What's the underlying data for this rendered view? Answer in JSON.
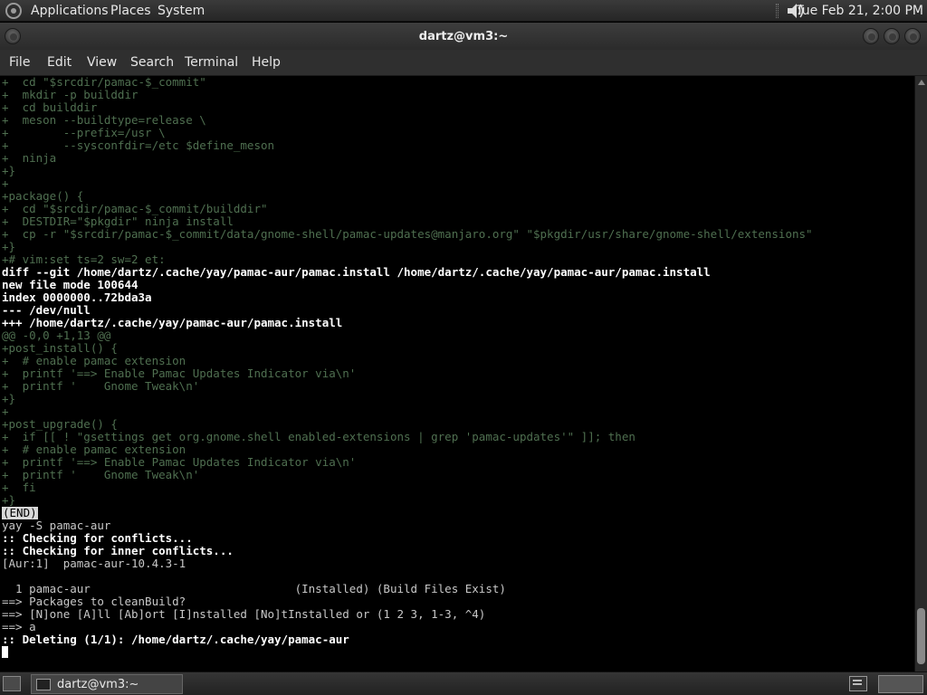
{
  "top_panel": {
    "menus": [
      "Applications",
      "Places",
      "System"
    ],
    "clock": "Tue Feb 21,  2:00 PM"
  },
  "window": {
    "title": "dartz@vm3:~"
  },
  "menubar": [
    "File",
    "Edit",
    "View",
    "Search",
    "Terminal",
    "Help"
  ],
  "terminal": {
    "lines": [
      {
        "style": "dim",
        "text": "+  cd \"$srcdir/pamac-$_commit\""
      },
      {
        "style": "dim",
        "text": "+  mkdir -p builddir"
      },
      {
        "style": "dim",
        "text": "+  cd builddir"
      },
      {
        "style": "dim",
        "text": "+  meson --buildtype=release \\"
      },
      {
        "style": "dim",
        "text": "+        --prefix=/usr \\"
      },
      {
        "style": "dim",
        "text": "+        --sysconfdir=/etc $define_meson"
      },
      {
        "style": "dim",
        "text": "+  ninja"
      },
      {
        "style": "dim",
        "text": "+}"
      },
      {
        "style": "dim",
        "text": "+"
      },
      {
        "style": "dim",
        "text": "+package() {"
      },
      {
        "style": "dim",
        "text": "+  cd \"$srcdir/pamac-$_commit/builddir\""
      },
      {
        "style": "dim",
        "text": "+  DESTDIR=\"$pkgdir\" ninja install"
      },
      {
        "style": "dim",
        "text": "+  cp -r \"$srcdir/pamac-$_commit/data/gnome-shell/pamac-updates@manjaro.org\" \"$pkgdir/usr/share/gnome-shell/extensions\""
      },
      {
        "style": "dim",
        "text": "+}"
      },
      {
        "style": "dim",
        "text": "+# vim:set ts=2 sw=2 et:"
      },
      {
        "style": "bold",
        "text": "diff --git /home/dartz/.cache/yay/pamac-aur/pamac.install /home/dartz/.cache/yay/pamac-aur/pamac.install"
      },
      {
        "style": "bold",
        "text": "new file mode 100644"
      },
      {
        "style": "bold",
        "text": "index 0000000..72bda3a"
      },
      {
        "style": "bold",
        "text": "--- /dev/null"
      },
      {
        "style": "bold",
        "text": "+++ /home/dartz/.cache/yay/pamac-aur/pamac.install"
      },
      {
        "style": "dim",
        "text": "@@ -0,0 +1,13 @@"
      },
      {
        "style": "dim",
        "text": "+post_install() {"
      },
      {
        "style": "dim",
        "text": "+  # enable pamac extension"
      },
      {
        "style": "dim",
        "text": "+  printf '==> Enable Pamac Updates Indicator via\\n'"
      },
      {
        "style": "dim",
        "text": "+  printf '    Gnome Tweak\\n'"
      },
      {
        "style": "dim",
        "text": "+}"
      },
      {
        "style": "dim",
        "text": "+"
      },
      {
        "style": "dim",
        "text": "+post_upgrade() {"
      },
      {
        "style": "dim",
        "text": "+  if [[ ! \"gsettings get org.gnome.shell enabled-extensions | grep 'pamac-updates'\" ]]; then"
      },
      {
        "style": "dim",
        "text": "+  # enable pamac extension"
      },
      {
        "style": "dim",
        "text": "+  printf '==> Enable Pamac Updates Indicator via\\n'"
      },
      {
        "style": "dim",
        "text": "+  printf '    Gnome Tweak\\n'"
      },
      {
        "style": "dim",
        "text": "+  fi"
      },
      {
        "style": "dim",
        "text": "+}"
      },
      {
        "style": "end",
        "text": "(END)"
      },
      {
        "style": "plain",
        "text": "yay -S pamac-aur"
      },
      {
        "style": "bold",
        "text": ":: Checking for conflicts..."
      },
      {
        "style": "bold",
        "text": ":: Checking for inner conflicts..."
      },
      {
        "style": "plain",
        "text": "[Aur:1]  pamac-aur-10.4.3-1"
      },
      {
        "style": "plain",
        "text": ""
      },
      {
        "style": "plain",
        "text": "  1 pamac-aur                              (Installed) (Build Files Exist)"
      },
      {
        "style": "plain",
        "text": "==> Packages to cleanBuild?"
      },
      {
        "style": "plain",
        "text": "==> [N]one [A]ll [Ab]ort [I]nstalled [No]tInstalled or (1 2 3, 1-3, ^4)"
      },
      {
        "style": "plain",
        "text": "==> a"
      },
      {
        "style": "bold",
        "text": ":: Deleting (1/1): /home/dartz/.cache/yay/pamac-aur"
      },
      {
        "style": "cursor",
        "text": ""
      }
    ]
  },
  "bottom_panel": {
    "task_label": "dartz@vm3:~"
  }
}
